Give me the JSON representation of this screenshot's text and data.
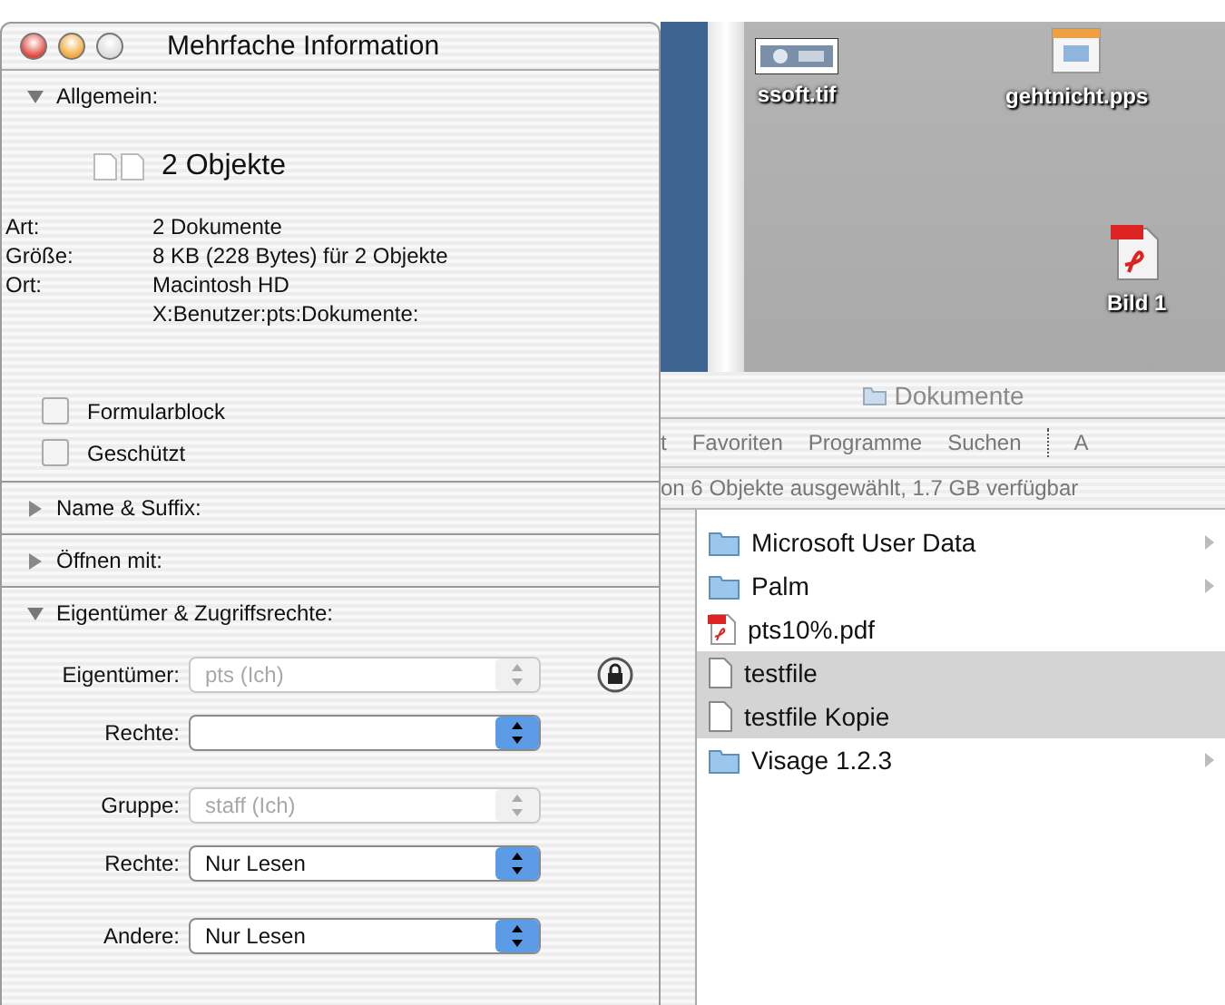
{
  "desktop": {
    "icons": [
      {
        "label": "ssoft.tif"
      },
      {
        "label": "gehtnicht.pps",
        "kind": "presentation"
      },
      {
        "label": "Bild 1",
        "kind": "pdf"
      }
    ]
  },
  "finder": {
    "title": "Dokumente",
    "toolbar": [
      {
        "kind": "item",
        "label": "t"
      },
      {
        "kind": "item",
        "label": "Favoriten"
      },
      {
        "kind": "item",
        "label": "Programme"
      },
      {
        "kind": "item",
        "label": "Suchen"
      },
      {
        "kind": "separator"
      },
      {
        "kind": "item",
        "label": "A"
      }
    ],
    "status": "on 6 Objekte ausgewählt, 1.7 GB verfügbar",
    "files": [
      {
        "name": "Microsoft User Data",
        "kind": "folder",
        "selected": false
      },
      {
        "name": "Palm",
        "kind": "folder",
        "selected": false
      },
      {
        "name": "pts10%.pdf",
        "kind": "pdf",
        "selected": false
      },
      {
        "name": "testfile",
        "kind": "document",
        "selected": true
      },
      {
        "name": "testfile Kopie",
        "kind": "document",
        "selected": true
      },
      {
        "name": "Visage 1.2.3",
        "kind": "folder",
        "selected": false
      }
    ]
  },
  "info_window": {
    "title": "Mehrfache Information",
    "general": {
      "label": "Allgemein:",
      "expanded": true,
      "summary": "2 Objekte",
      "fields": [
        {
          "label": "Art:",
          "lines": [
            "2 Dokumente"
          ]
        },
        {
          "label": "Größe:",
          "lines": [
            "8 KB (228 Bytes) für 2 Objekte"
          ]
        },
        {
          "label": "Ort:",
          "lines": [
            "Macintosh HD",
            "X:Benutzer:pts:Dokumente:"
          ]
        }
      ],
      "checkboxes": [
        {
          "label": "Formularblock",
          "checked": false
        },
        {
          "label": "Geschützt",
          "checked": false
        }
      ]
    },
    "collapsed": [
      {
        "label": "Name & Suffix:",
        "expanded": false
      },
      {
        "label": "Öffnen mit:",
        "expanded": false
      }
    ],
    "permissions": {
      "label": "Eigentümer & Zugriffsrechte:",
      "expanded": true,
      "locked": true,
      "groups": [
        [
          {
            "label": "Eigentümer:",
            "value": "pts (Ich)",
            "disabled": true
          },
          {
            "label": "Rechte:",
            "disabled": false
          }
        ],
        [
          {
            "label": "Gruppe:",
            "value": "staff (Ich)",
            "disabled": true
          },
          {
            "label": "Rechte:",
            "value": "Nur Lesen",
            "disabled": false
          }
        ],
        [
          {
            "label": "Andere:",
            "value": "Nur Lesen",
            "disabled": false
          }
        ]
      ]
    }
  }
}
